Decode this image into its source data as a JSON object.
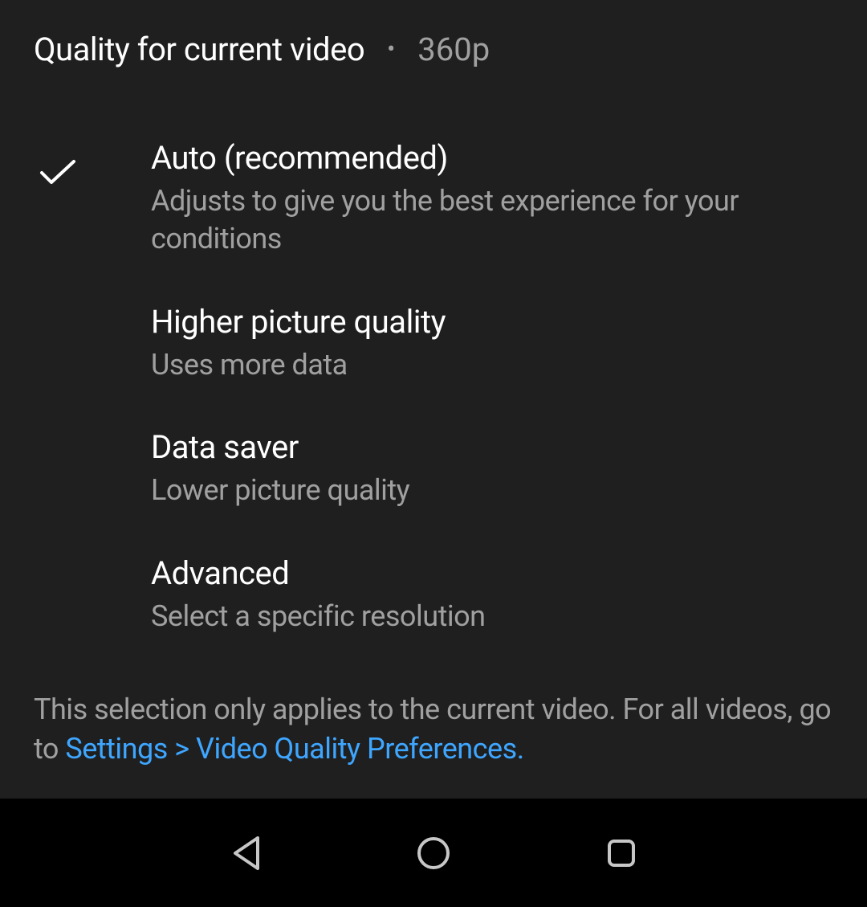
{
  "header": {
    "title": "Quality for current video",
    "bullet": "•",
    "current_value": "360p"
  },
  "options": [
    {
      "selected": true,
      "title": "Auto (recommended)",
      "desc": "Adjusts to give you the best experience for your conditions"
    },
    {
      "selected": false,
      "title": "Higher picture quality",
      "desc": "Uses more data"
    },
    {
      "selected": false,
      "title": "Data saver",
      "desc": "Lower picture quality"
    },
    {
      "selected": false,
      "title": "Advanced",
      "desc": "Select a specific resolution"
    }
  ],
  "footer": {
    "text_before": "This selection only applies to the current video. For all videos, go to ",
    "link_text": "Settings > Video Quality Preferences."
  }
}
